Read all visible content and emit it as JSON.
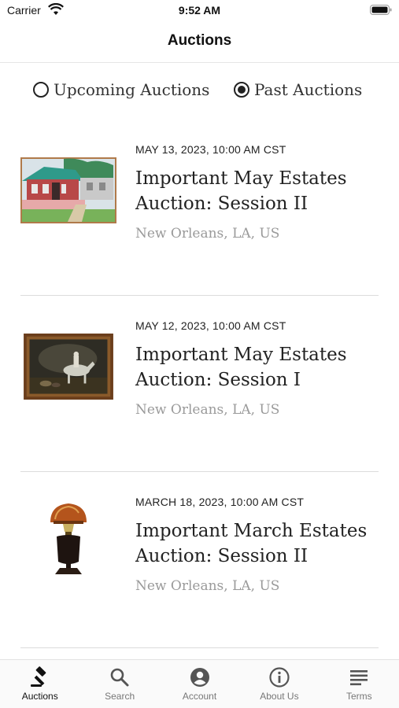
{
  "status_bar": {
    "carrier": "Carrier",
    "time": "9:52 AM"
  },
  "nav": {
    "title": "Auctions"
  },
  "filter": {
    "options": [
      {
        "label": "Upcoming Auctions",
        "selected": false
      },
      {
        "label": "Past Auctions",
        "selected": true
      }
    ]
  },
  "auctions": [
    {
      "date": "MAY 13, 2023, 10:00 AM CST",
      "title": "Important May Estates Auction: Session II",
      "location": "New Orleans, LA, US",
      "image": "house-painting"
    },
    {
      "date": "MAY 12, 2023, 10:00 AM CST",
      "title": "Important May Estates Auction: Session I",
      "location": "New Orleans, LA, US",
      "image": "horse-painting"
    },
    {
      "date": "MARCH 18, 2023, 10:00 AM CST",
      "title": "Important March Estates Auction: Session II",
      "location": "New Orleans, LA, US",
      "image": "oil-lamp"
    }
  ],
  "tabs": [
    {
      "label": "Auctions",
      "icon": "gavel-icon",
      "active": true
    },
    {
      "label": "Search",
      "icon": "search-icon",
      "active": false
    },
    {
      "label": "Account",
      "icon": "account-icon",
      "active": false
    },
    {
      "label": "About Us",
      "icon": "info-icon",
      "active": false
    },
    {
      "label": "Terms",
      "icon": "terms-icon",
      "active": false
    }
  ]
}
